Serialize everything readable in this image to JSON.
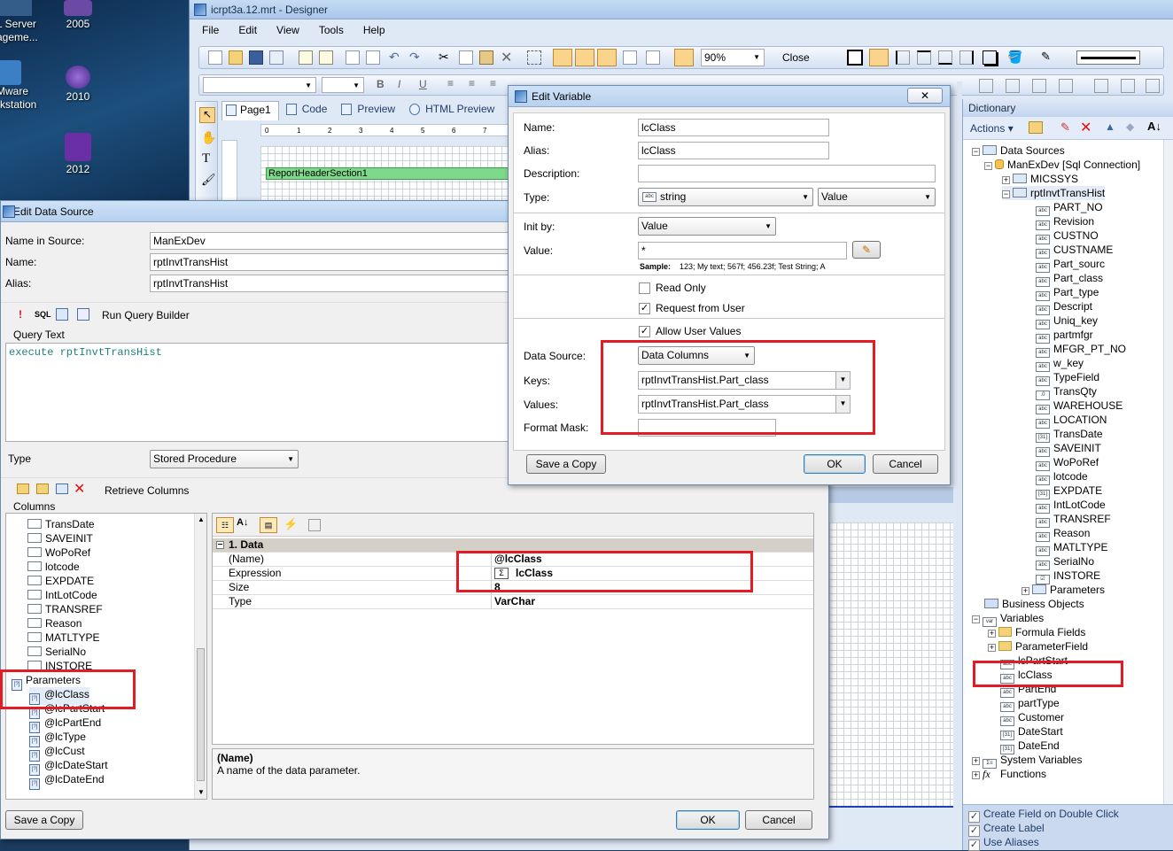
{
  "desktop": {
    "icons": [
      {
        "label": "L Server\nageme...",
        "name": "sql-server-icon"
      },
      {
        "label": "2005",
        "name": "vs2005-icon"
      },
      {
        "label": "Mware\nrkstation",
        "name": "vmware-icon"
      },
      {
        "label": "2010",
        "name": "vs2010-icon"
      },
      {
        "label": "2012",
        "name": "vs2012-icon"
      }
    ]
  },
  "designer": {
    "title": "icrpt3a.12.mrt - Designer",
    "menu": [
      "File",
      "Edit",
      "View",
      "Tools",
      "Help"
    ],
    "zoom": "90%",
    "close_label": "Close",
    "tabs": [
      "Page1",
      "Code",
      "Preview",
      "HTML Preview"
    ],
    "band_header": "ReportHeaderSection1",
    "ruler": [
      "0",
      "1",
      "2",
      "3",
      "4",
      "5",
      "6",
      "7"
    ]
  },
  "dictionary": {
    "title": "Dictionary",
    "actions_label": "Actions",
    "data_sources_label": "Data Sources",
    "connection_label": "ManExDev [Sql Connection]",
    "micssys_label": "MICSSYS",
    "table_label": "rptInvtTransHist",
    "fields": [
      {
        "label": "PART_NO",
        "kind": "abc"
      },
      {
        "label": "Revision",
        "kind": "abc"
      },
      {
        "label": "CUSTNO",
        "kind": "abc"
      },
      {
        "label": "CUSTNAME",
        "kind": "abc"
      },
      {
        "label": "Part_sourc",
        "kind": "abc"
      },
      {
        "label": "Part_class",
        "kind": "abc"
      },
      {
        "label": "Part_type",
        "kind": "abc"
      },
      {
        "label": "Descript",
        "kind": "abc"
      },
      {
        "label": "Uniq_key",
        "kind": "abc"
      },
      {
        "label": "partmfgr",
        "kind": "abc"
      },
      {
        "label": "MFGR_PT_NO",
        "kind": "abc"
      },
      {
        "label": "w_key",
        "kind": "abc"
      },
      {
        "label": "TypeField",
        "kind": "abc"
      },
      {
        "label": "TransQty",
        "kind": ".0"
      },
      {
        "label": "WAREHOUSE",
        "kind": "abc"
      },
      {
        "label": "LOCATION",
        "kind": "abc"
      },
      {
        "label": "TransDate",
        "kind": "date"
      },
      {
        "label": "SAVEINIT",
        "kind": "abc"
      },
      {
        "label": "WoPoRef",
        "kind": "abc"
      },
      {
        "label": "lotcode",
        "kind": "abc"
      },
      {
        "label": "EXPDATE",
        "kind": "date"
      },
      {
        "label": "IntLotCode",
        "kind": "abc"
      },
      {
        "label": "TRANSREF",
        "kind": "abc"
      },
      {
        "label": "Reason",
        "kind": "abc"
      },
      {
        "label": "MATLTYPE",
        "kind": "abc"
      },
      {
        "label": "SerialNo",
        "kind": "abc"
      },
      {
        "label": "INSTORE",
        "kind": "bool"
      }
    ],
    "parameters_label": "Parameters",
    "business_objects_label": "Business Objects",
    "variables_label": "Variables",
    "variable_folders": [
      "Formula Fields",
      "ParameterField"
    ],
    "variables": [
      {
        "label": "lcPartStart",
        "kind": "abc"
      },
      {
        "label": "lcClass",
        "kind": "abc"
      },
      {
        "label": "PartEnd",
        "kind": "abc"
      },
      {
        "label": "partType",
        "kind": "abc"
      },
      {
        "label": "Customer",
        "kind": "abc"
      },
      {
        "label": "DateStart",
        "kind": "date"
      },
      {
        "label": "DateEnd",
        "kind": "date"
      }
    ],
    "system_variables_label": "System Variables",
    "functions_label": "Functions",
    "options": [
      "Create Field on Double Click",
      "Create Label",
      "Use Aliases"
    ]
  },
  "edit_data_source": {
    "title": "Edit Data Source",
    "name_in_source_label": "Name in Source:",
    "name_in_source": "ManExDev",
    "name_label": "Name:",
    "name": "rptInvtTransHist",
    "alias_label": "Alias:",
    "alias": "rptInvtTransHist",
    "sql_label": "SQL",
    "run_query_builder": "Run Query Builder",
    "query_text_label": "Query Text",
    "query_text": "execute rptInvtTransHist",
    "type_label": "Type",
    "type_value": "Stored Procedure",
    "retrieve_columns": "Retrieve Columns",
    "columns_label": "Columns",
    "columns": [
      "TransDate",
      "SAVEINIT",
      "WoPoRef",
      "lotcode",
      "EXPDATE",
      "IntLotCode",
      "TRANSREF",
      "Reason",
      "MATLTYPE",
      "SerialNo",
      "INSTORE"
    ],
    "parameters_label": "Parameters",
    "parameters": [
      "@lcClass",
      "@lcPartStart",
      "@lcPartEnd",
      "@lcType",
      "@lcCust",
      "@lcDateStart",
      "@lcDateEnd"
    ],
    "prop_category": "1. Data",
    "props": [
      {
        "name": "(Name)",
        "value": "@lcClass"
      },
      {
        "name": "Expression",
        "value": "lcClass"
      },
      {
        "name": "Size",
        "value": "8"
      },
      {
        "name": "Type",
        "value": "VarChar"
      }
    ],
    "desc_title": "(Name)",
    "desc_text": "A name of the data parameter.",
    "save_copy": "Save a Copy",
    "ok": "OK",
    "cancel": "Cancel"
  },
  "edit_variable": {
    "title": "Edit Variable",
    "name_label": "Name:",
    "name": "lcClass",
    "alias_label": "Alias:",
    "alias": "lcClass",
    "description_label": "Description:",
    "description": "",
    "type_label": "Type:",
    "type_value": "string",
    "type_kind": "Value",
    "init_by_label": "Init by:",
    "init_by": "Value",
    "value_label": "Value:",
    "value": "*",
    "sample_label": "Sample:",
    "sample_text": "123; My text; 567f; 456.23f; Test String; A",
    "read_only": "Read Only",
    "request_from_user": "Request from User",
    "allow_user_values": "Allow User Values",
    "data_source_label": "Data Source:",
    "data_source": "Data Columns",
    "keys_label": "Keys:",
    "keys": "rptInvtTransHist.Part_class",
    "values_label": "Values:",
    "values": "rptInvtTransHist.Part_class",
    "format_mask_label": "Format Mask:",
    "format_mask": "",
    "save_copy": "Save a Copy",
    "ok": "OK",
    "cancel": "Cancel"
  },
  "colors": {
    "highlight": "#e31c23",
    "window_bg": "#f0f0f0",
    "designer_bg": "#dfe8f5",
    "band_green": "#7fd98a"
  }
}
